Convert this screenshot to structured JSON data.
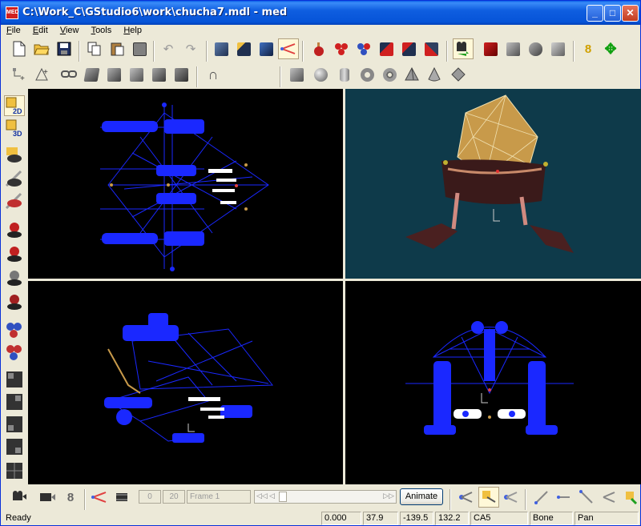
{
  "window": {
    "title": "C:\\Work_C\\GStudio6\\work\\chucha7.mdl - med",
    "app_icon_text": "MED"
  },
  "title_buttons": {
    "minimize": "_",
    "maximize": "□",
    "close": "✕"
  },
  "menu": [
    {
      "label": "File",
      "hotkey": "F"
    },
    {
      "label": "Edit",
      "hotkey": "E"
    },
    {
      "label": "View",
      "hotkey": "V"
    },
    {
      "label": "Tools",
      "hotkey": "T"
    },
    {
      "label": "Help",
      "hotkey": "H"
    }
  ],
  "left_labels": {
    "view2d": "2D",
    "view3d": "3D"
  },
  "bottom": {
    "frame_start": "0",
    "frame_end": "20",
    "frame_name_placeholder": "Frame 1",
    "animate_label": "Animate",
    "slider_left": "◁◁",
    "slider_arrow": "◁",
    "slider_right": "▷▷"
  },
  "status": {
    "ready": "Ready",
    "v1": "0.000",
    "v2": "37.9",
    "v3": "-139.5",
    "v4": "132.2",
    "name": "CA5",
    "mode": "Bone",
    "tool": "Pan"
  },
  "colors": {
    "viewport_bg": "#000000",
    "viewport_3d_bg": "#0e3a4a",
    "mesh_blue": "#1a28ff",
    "mesh_gold": "#c89a4a",
    "titlebar": "#0654d8"
  }
}
